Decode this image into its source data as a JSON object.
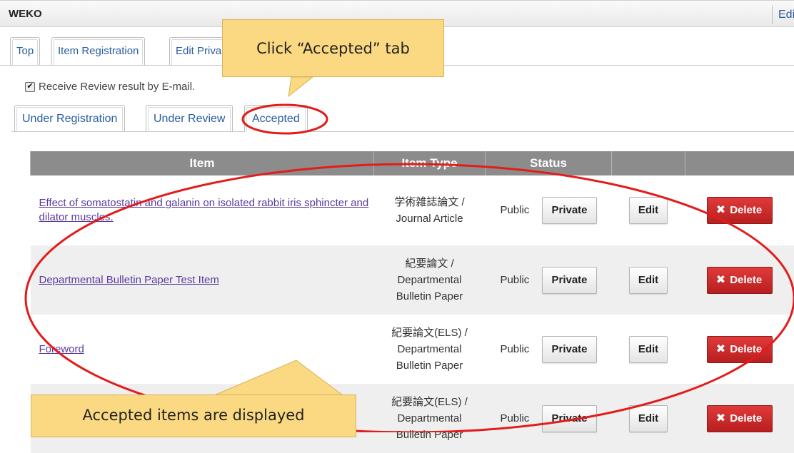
{
  "app": {
    "name": "WEKO",
    "edit_link": "Edit"
  },
  "top_tabs": [
    "Top",
    "Item Registration",
    "Edit Privacy"
  ],
  "review_option": {
    "label": "Receive Review result by E-mail.",
    "checked": true,
    "check_glyph": "✔"
  },
  "sub_tabs": [
    "Under Registration",
    "Under Review",
    "Accepted"
  ],
  "table": {
    "headers": [
      "Item",
      "Item Type",
      "Status",
      "",
      ""
    ],
    "rows": [
      {
        "title": "Effect of somatostatin and galanin on isolated rabbit iris sphincter and dilator muscles.",
        "type_line1": "学術雑誌論文 /",
        "type_line2": "Journal Article",
        "type_line3": "",
        "status": "Public",
        "private_label": "Private",
        "edit_label": "Edit",
        "delete_label": "Delete"
      },
      {
        "title": "Departmental Bulletin Paper Test Item",
        "type_line1": "紀要論文 /",
        "type_line2": "Departmental",
        "type_line3": "Bulletin Paper",
        "status": "Public",
        "private_label": "Private",
        "edit_label": "Edit",
        "delete_label": "Delete"
      },
      {
        "title": "Foreword",
        "type_line1": "紀要論文(ELS) /",
        "type_line2": "Departmental",
        "type_line3": "Bulletin Paper",
        "status": "Public",
        "private_label": "Private",
        "edit_label": "Edit",
        "delete_label": "Delete"
      },
      {
        "title": "",
        "type_line1": "紀要論文(ELS) /",
        "type_line2": "Departmental",
        "type_line3": "Bulletin Paper",
        "status": "Public",
        "private_label": "Private",
        "edit_label": "Edit",
        "delete_label": "Delete"
      }
    ]
  },
  "annotations": {
    "top_callout": "Click “Accepted” tab",
    "bottom_callout": "Accepted items are displayed",
    "highlight_color": "#e31b1b",
    "callout_color": "#fbd982"
  },
  "colors": {
    "link": "#2a5d9f",
    "visited_link": "#5a3a9c",
    "table_header": "#8c8c8c",
    "delete_button": "#c62828"
  }
}
